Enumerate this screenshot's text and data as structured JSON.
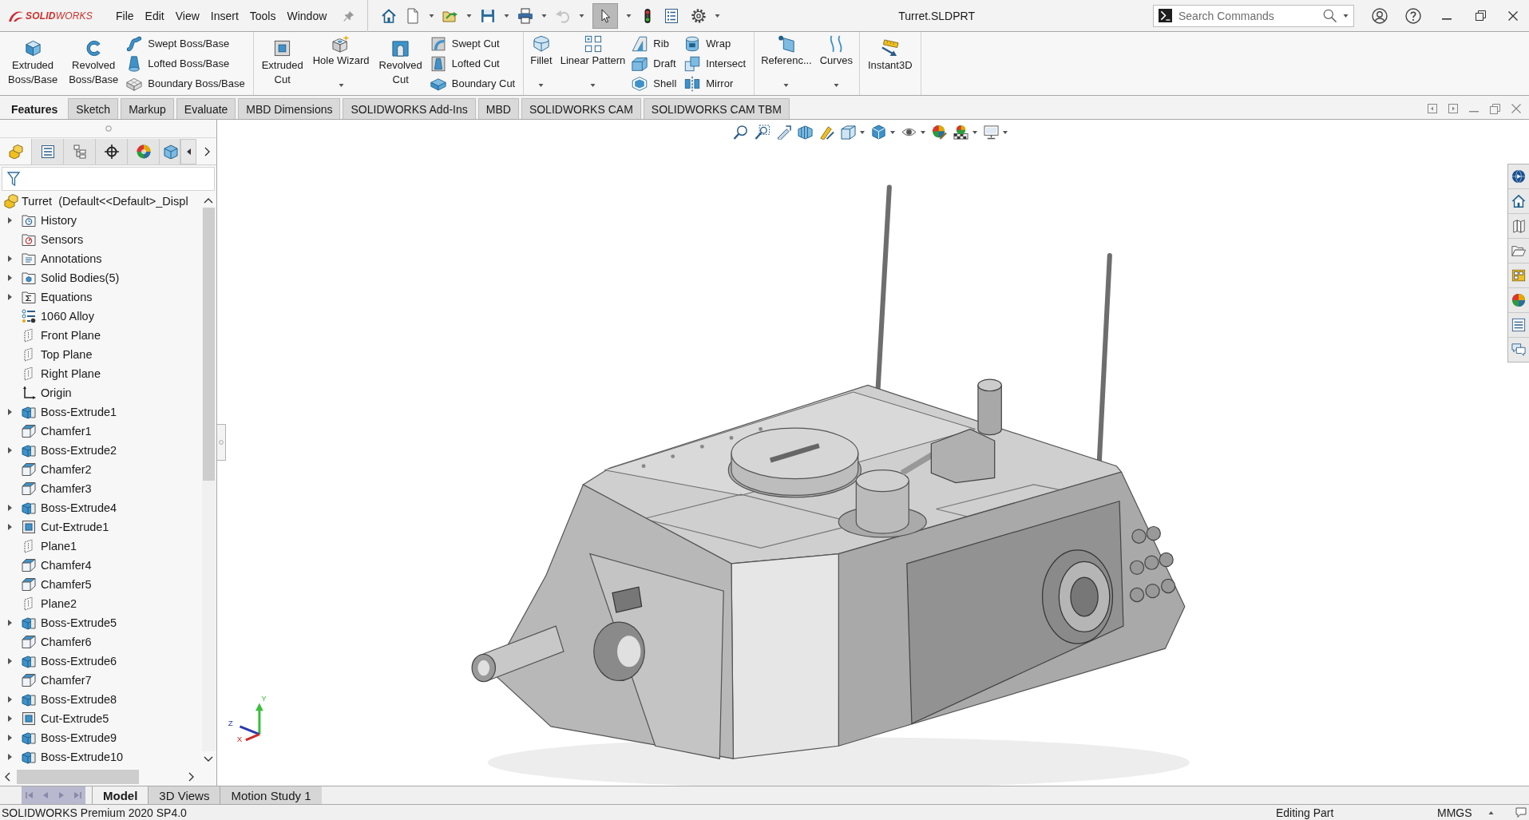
{
  "app": {
    "logo": "**SOLID**WORKS",
    "menu": [
      "File",
      "Edit",
      "View",
      "Insert",
      "Tools",
      "Window"
    ],
    "title": "Turret.SLDPRT",
    "search": {
      "placeholder": "Search Commands"
    }
  },
  "quick_access": {
    "undo_disabled": true,
    "select_on": true
  },
  "command_groups": [
    {
      "items": [
        {
          "kind": "large",
          "label": "Extruded Boss/Base",
          "dropdown": false
        },
        {
          "kind": "large",
          "label": "Revolved Boss/Base",
          "dropdown": false
        },
        {
          "kind": "stack",
          "labels": [
            "Swept Boss/Base",
            "Lofted Boss/Base",
            "Boundary Boss/Base"
          ]
        }
      ]
    },
    {
      "items": [
        {
          "kind": "large",
          "label": "Extruded Cut",
          "dropdown": false
        },
        {
          "kind": "large",
          "label": "Hole Wizard",
          "dropdown": true
        },
        {
          "kind": "large",
          "label": "Revolved Cut",
          "dropdown": false
        },
        {
          "kind": "stack",
          "labels": [
            "Swept Cut",
            "Lofted Cut",
            "Boundary Cut"
          ]
        }
      ]
    },
    {
      "items": [
        {
          "kind": "large",
          "label": "Fillet",
          "dropdown": true
        },
        {
          "kind": "large",
          "label": "Linear Pattern",
          "dropdown": true
        },
        {
          "kind": "stack",
          "labels": [
            "Rib",
            "Draft",
            "Shell"
          ]
        },
        {
          "kind": "stack",
          "labels": [
            "Wrap",
            "Intersect",
            "Mirror"
          ]
        }
      ]
    },
    {
      "items": [
        {
          "kind": "large",
          "label": "Referenc...",
          "dropdown": true
        },
        {
          "kind": "large",
          "label": "Curves",
          "dropdown": true
        }
      ]
    },
    {
      "items": [
        {
          "kind": "large",
          "label": "Instant3D",
          "dropdown": false
        }
      ]
    }
  ],
  "tabs": [
    {
      "label": "Features",
      "selected": true
    },
    {
      "label": "Sketch",
      "selected": false
    },
    {
      "label": "Markup",
      "selected": false
    },
    {
      "label": "Evaluate",
      "selected": false
    },
    {
      "label": "MBD Dimensions",
      "selected": false
    },
    {
      "label": "SOLIDWORKS Add-Ins",
      "selected": false
    },
    {
      "label": "MBD",
      "selected": false
    },
    {
      "label": "SOLIDWORKS CAM",
      "selected": false
    },
    {
      "label": "SOLIDWORKS CAM TBM",
      "selected": false
    }
  ],
  "feature_manager": {
    "panel_tabs": [
      {
        "selected": true
      },
      {
        "selected": false
      },
      {
        "selected": false
      },
      {
        "selected": false
      },
      {
        "selected": false
      },
      {
        "selected": false
      }
    ],
    "root": {
      "label": "Turret  (Default<<Default>_Displ"
    },
    "items": [
      {
        "label": "History",
        "kind": "history",
        "expandable": true
      },
      {
        "label": "Sensors",
        "kind": "sensors",
        "expandable": false
      },
      {
        "label": "Annotations",
        "kind": "annotations",
        "expandable": true
      },
      {
        "label": "Solid Bodies(5)",
        "kind": "bodies",
        "expandable": true
      },
      {
        "label": "Equations",
        "kind": "equations",
        "expandable": true
      },
      {
        "label": "1060 Alloy",
        "kind": "material",
        "expandable": false
      },
      {
        "label": "Front Plane",
        "kind": "plane",
        "expandable": false
      },
      {
        "label": "Top Plane",
        "kind": "plane",
        "expandable": false
      },
      {
        "label": "Right Plane",
        "kind": "plane",
        "expandable": false
      },
      {
        "label": "Origin",
        "kind": "origin",
        "expandable": false
      },
      {
        "label": "Boss-Extrude1",
        "kind": "boss",
        "expandable": true
      },
      {
        "label": "Chamfer1",
        "kind": "chamfer",
        "expandable": false
      },
      {
        "label": "Boss-Extrude2",
        "kind": "boss",
        "expandable": true
      },
      {
        "label": "Chamfer2",
        "kind": "chamfer",
        "expandable": false
      },
      {
        "label": "Chamfer3",
        "kind": "chamfer",
        "expandable": false
      },
      {
        "label": "Boss-Extrude4",
        "kind": "boss",
        "expandable": true
      },
      {
        "label": "Cut-Extrude1",
        "kind": "cut",
        "expandable": true
      },
      {
        "label": "Plane1",
        "kind": "plane",
        "expandable": false
      },
      {
        "label": "Chamfer4",
        "kind": "chamfer",
        "expandable": false
      },
      {
        "label": "Chamfer5",
        "kind": "chamfer",
        "expandable": false
      },
      {
        "label": "Plane2",
        "kind": "plane",
        "expandable": false
      },
      {
        "label": "Boss-Extrude5",
        "kind": "boss",
        "expandable": true
      },
      {
        "label": "Chamfer6",
        "kind": "chamfer",
        "expandable": false
      },
      {
        "label": "Boss-Extrude6",
        "kind": "boss",
        "expandable": true
      },
      {
        "label": "Chamfer7",
        "kind": "chamfer",
        "expandable": false
      },
      {
        "label": "Boss-Extrude8",
        "kind": "boss",
        "expandable": true
      },
      {
        "label": "Cut-Extrude5",
        "kind": "cut",
        "expandable": true
      },
      {
        "label": "Boss-Extrude9",
        "kind": "boss",
        "expandable": true
      },
      {
        "label": "Boss-Extrude10",
        "kind": "boss",
        "expandable": true
      }
    ]
  },
  "graphics": {
    "triad_axes": [
      "Y",
      "Z",
      "X"
    ]
  },
  "bottom_tabs": [
    {
      "label": "Model",
      "selected": true
    },
    {
      "label": "3D Views",
      "selected": false
    },
    {
      "label": "Motion Study 1",
      "selected": false
    }
  ],
  "status_bar": {
    "product": "SOLIDWORKS Premium 2020 SP4.0",
    "mode": "Editing Part",
    "units": "MMGS"
  }
}
